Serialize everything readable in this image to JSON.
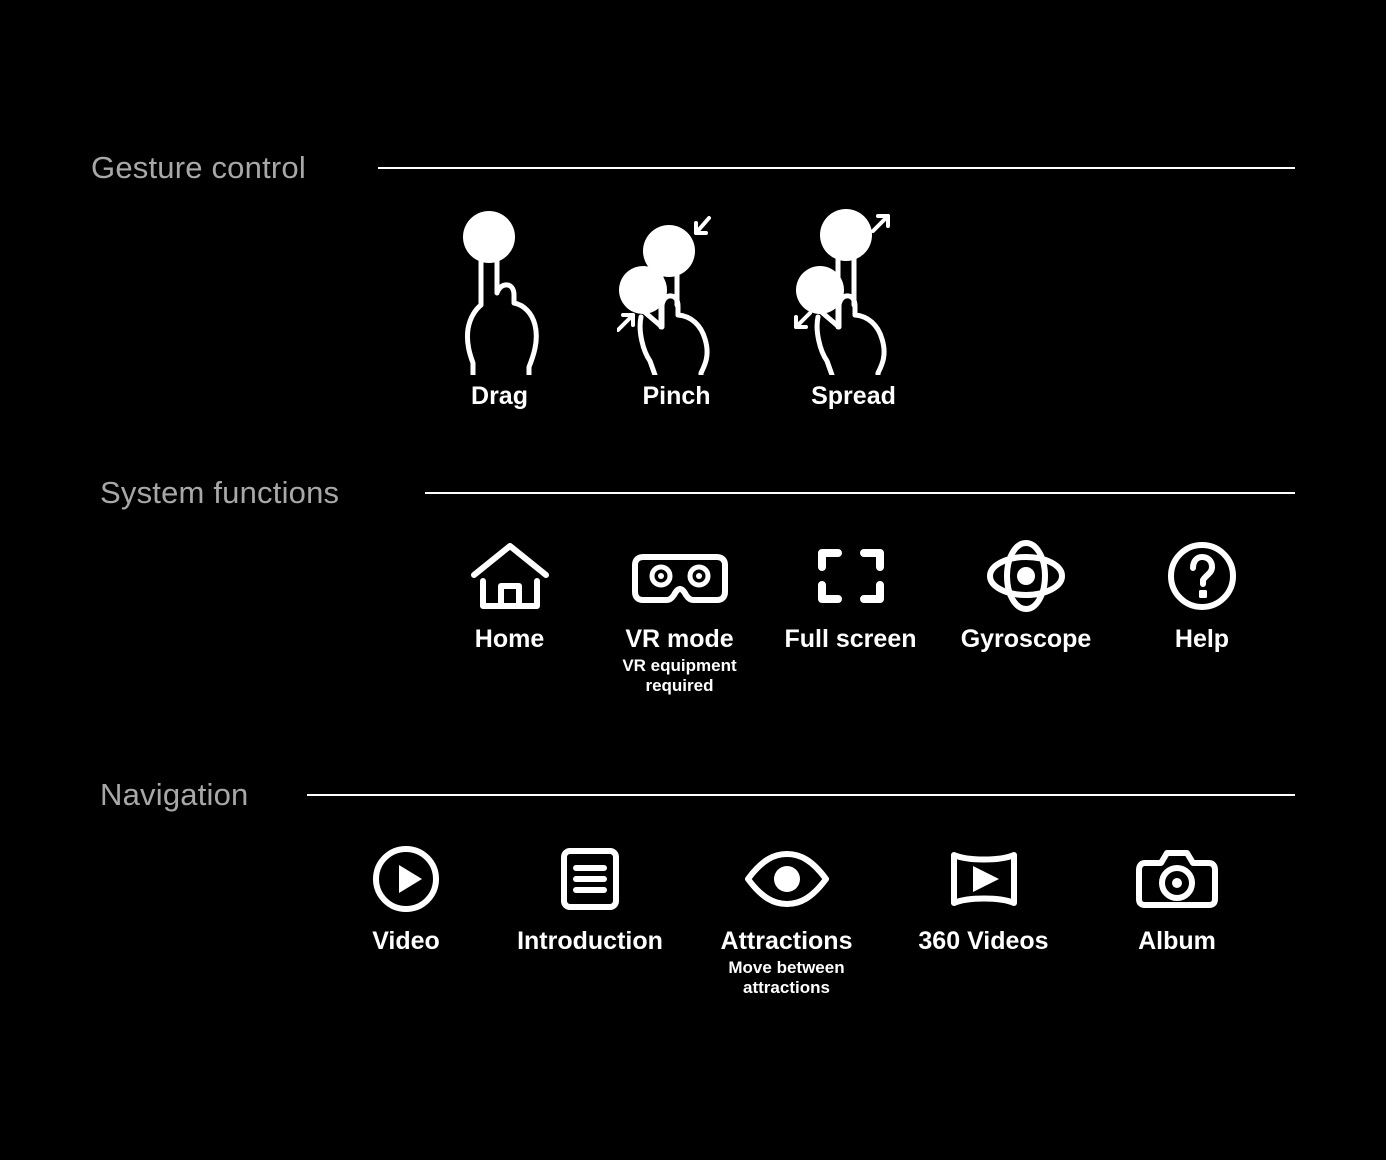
{
  "page": {
    "background_color": "#000000",
    "text_color": "#ffffff",
    "section_title_color": "#a8a8a8",
    "rule_color": "#ffffff"
  },
  "sections": [
    {
      "id": "gesture-control",
      "title": "Gesture control",
      "items": [
        {
          "label": "Drag",
          "sub": "",
          "icon": "hand-drag-icon"
        },
        {
          "label": "Pinch",
          "sub": "",
          "icon": "hand-pinch-icon"
        },
        {
          "label": "Spread",
          "sub": "",
          "icon": "hand-spread-icon"
        }
      ]
    },
    {
      "id": "system-functions",
      "title": "System functions",
      "items": [
        {
          "label": "Home",
          "sub": "",
          "icon": "home-icon"
        },
        {
          "label": "VR mode",
          "sub": "VR equipment\nrequired",
          "icon": "vr-goggles-icon"
        },
        {
          "label": "Full screen",
          "sub": "",
          "icon": "fullscreen-icon"
        },
        {
          "label": "Gyroscope",
          "sub": "",
          "icon": "gyroscope-icon"
        },
        {
          "label": "Help",
          "sub": "",
          "icon": "help-question-icon"
        }
      ]
    },
    {
      "id": "navigation",
      "title": "Navigation",
      "items": [
        {
          "label": "Video",
          "sub": "",
          "icon": "play-circle-icon"
        },
        {
          "label": "Introduction",
          "sub": "",
          "icon": "document-lines-icon"
        },
        {
          "label": "Attractions",
          "sub": "Move between\nattractions",
          "icon": "eye-icon"
        },
        {
          "label": "360 Videos",
          "sub": "",
          "icon": "panorama-video-icon"
        },
        {
          "label": "Album",
          "sub": "",
          "icon": "camera-icon"
        }
      ]
    }
  ]
}
